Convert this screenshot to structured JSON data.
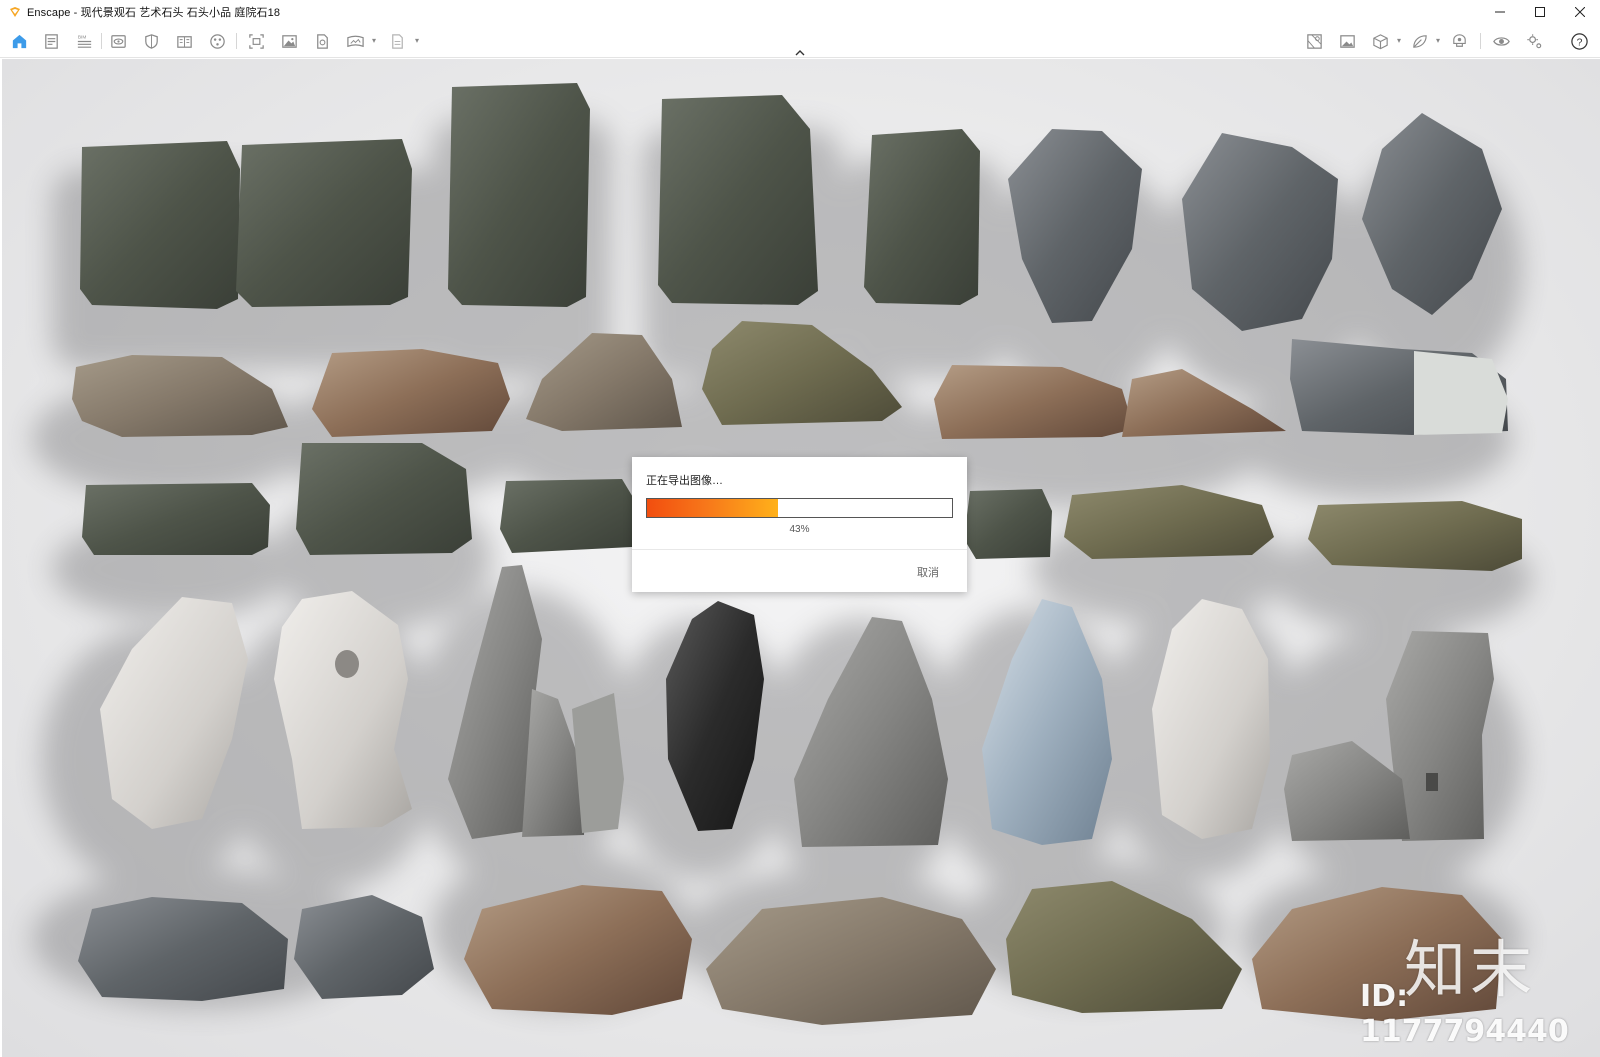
{
  "window": {
    "title": "Enscape - 现代景观石 艺术石头 石头小品 庭院石18",
    "controls": {
      "minimize": "—",
      "maximize": "☐",
      "close": "✕"
    }
  },
  "toolbar": {
    "left_icons": [
      "home-icon",
      "document-icon",
      "bim-icon",
      "eye-view-icon",
      "shield-icon",
      "book-icon",
      "palette-icon",
      "screenshot-icon",
      "image-icon",
      "file-export-icon",
      "panorama-icon",
      "batch-export-icon"
    ],
    "right_icons": [
      "map-icon",
      "gallery-icon",
      "cube-icon",
      "leaf-icon",
      "vr-headset-icon",
      "visibility-icon",
      "settings-icon",
      "help-icon"
    ],
    "help_glyph": "?",
    "accent": "#3d9be9"
  },
  "export_dialog": {
    "title": "正在导出图像…",
    "progress_fraction": 0.43,
    "progress_label": "43%",
    "cancel_label": "取消",
    "progress_colors": [
      "#f24e0f",
      "#ffb11a"
    ]
  },
  "watermark": {
    "brand": "知末",
    "id_text": "ID: 1177794440"
  }
}
